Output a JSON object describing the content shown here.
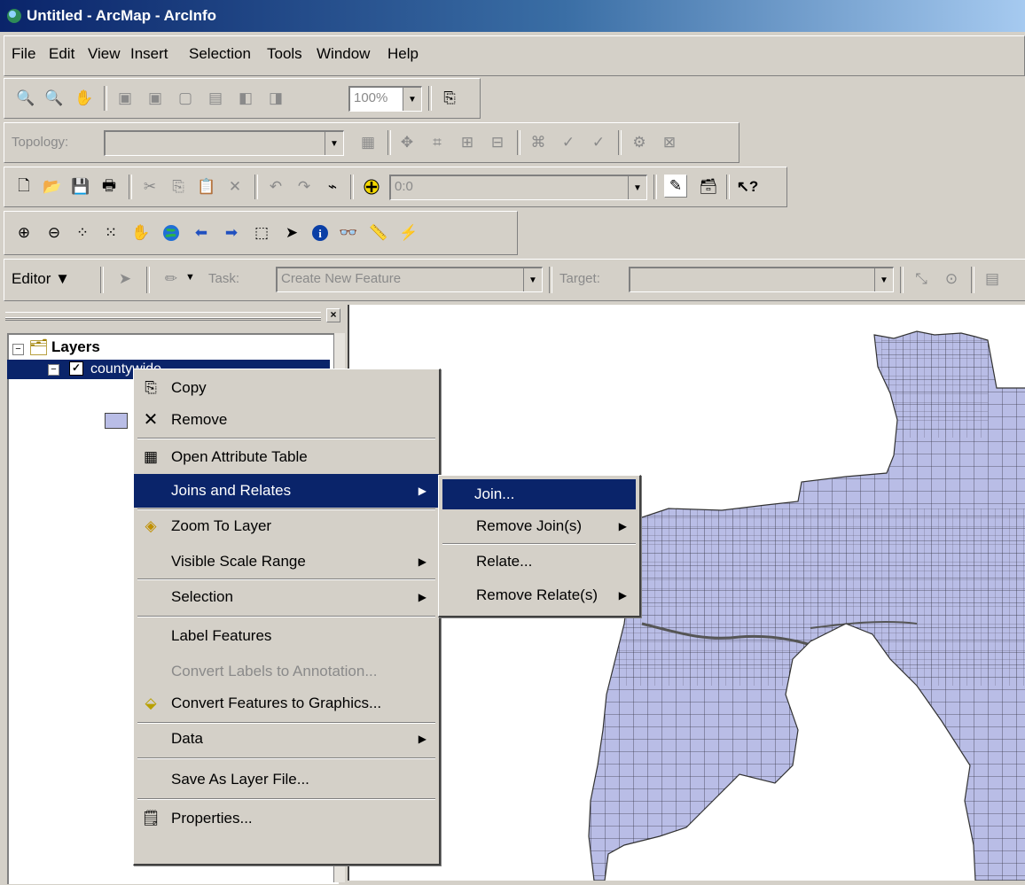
{
  "window": {
    "title": "Untitled - ArcMap - ArcInfo"
  },
  "menubar": [
    "File",
    "Edit",
    "View",
    "Insert",
    "Selection",
    "Tools",
    "Window",
    "Help"
  ],
  "layout_toolbar": {
    "zoom_value": "100%"
  },
  "topology_toolbar": {
    "label": "Topology:"
  },
  "standard_toolbar": {
    "scale_value": "0:0"
  },
  "editor_toolbar": {
    "editor_label": "Editor",
    "task_label": "Task:",
    "task_value": "Create New Feature",
    "target_label": "Target:"
  },
  "toc": {
    "root_label": "Layers",
    "layer_label": "countywide"
  },
  "context_menu": {
    "items": [
      {
        "label": "Copy",
        "icon": "copy-icon"
      },
      {
        "label": "Remove",
        "icon": "remove-icon"
      },
      {
        "label": "Open Attribute Table",
        "icon": "table-icon"
      },
      {
        "label": "Joins and Relates",
        "submenu": true,
        "highlighted": true
      },
      {
        "label": "Zoom To Layer",
        "icon": "zoom-layer-icon"
      },
      {
        "label": "Visible Scale Range",
        "submenu": true
      },
      {
        "label": "Selection",
        "submenu": true
      },
      {
        "label": "Label Features"
      },
      {
        "label": "Convert Labels to Annotation...",
        "disabled": true
      },
      {
        "label": "Convert Features to Graphics...",
        "icon": "convert-graphics-icon"
      },
      {
        "label": "Data",
        "submenu": true
      },
      {
        "label": "Save As Layer File..."
      },
      {
        "label": "Properties...",
        "icon": "properties-icon"
      }
    ]
  },
  "submenu": {
    "items": [
      {
        "label": "Join...",
        "highlighted": true
      },
      {
        "label": "Remove Join(s)",
        "submenu": true
      },
      {
        "label": "Relate..."
      },
      {
        "label": "Remove Relate(s)",
        "submenu": true
      }
    ]
  },
  "colors": {
    "map_fill": "#b9bde6",
    "map_line": "#3a3a4a",
    "selection": "#0a246a"
  }
}
